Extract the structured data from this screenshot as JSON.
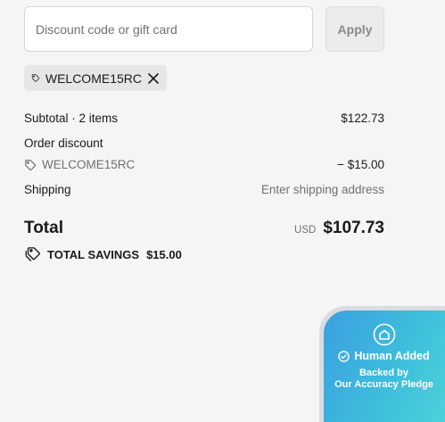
{
  "discount": {
    "placeholder": "Discount code or gift card",
    "apply_label": "Apply",
    "applied_code": "WELCOME15RC"
  },
  "summary": {
    "subtotal_label": "Subtotal · 2 items",
    "subtotal_value": "$122.73",
    "order_discount_label": "Order discount",
    "discount_code": "WELCOME15RC",
    "discount_value": "− $15.00",
    "shipping_label": "Shipping",
    "shipping_value": "Enter shipping address",
    "total_label": "Total",
    "currency": "USD",
    "total_value": "$107.73",
    "savings_label": "TOTAL SAVINGS",
    "savings_value": "$15.00"
  },
  "badge": {
    "title": "Human Added",
    "line1": "Backed by",
    "line2": "Our Accuracy Pledge"
  },
  "icons": {
    "tag": "tag-icon",
    "close": "close-icon",
    "savings": "savings-tag-icon",
    "home": "home-icon",
    "check": "check-circle-icon"
  },
  "colors": {
    "background": "#f5f5f5",
    "chip": "#e6e6e6",
    "badge_start": "#3aa0e0",
    "badge_end": "#4fd6d9"
  }
}
